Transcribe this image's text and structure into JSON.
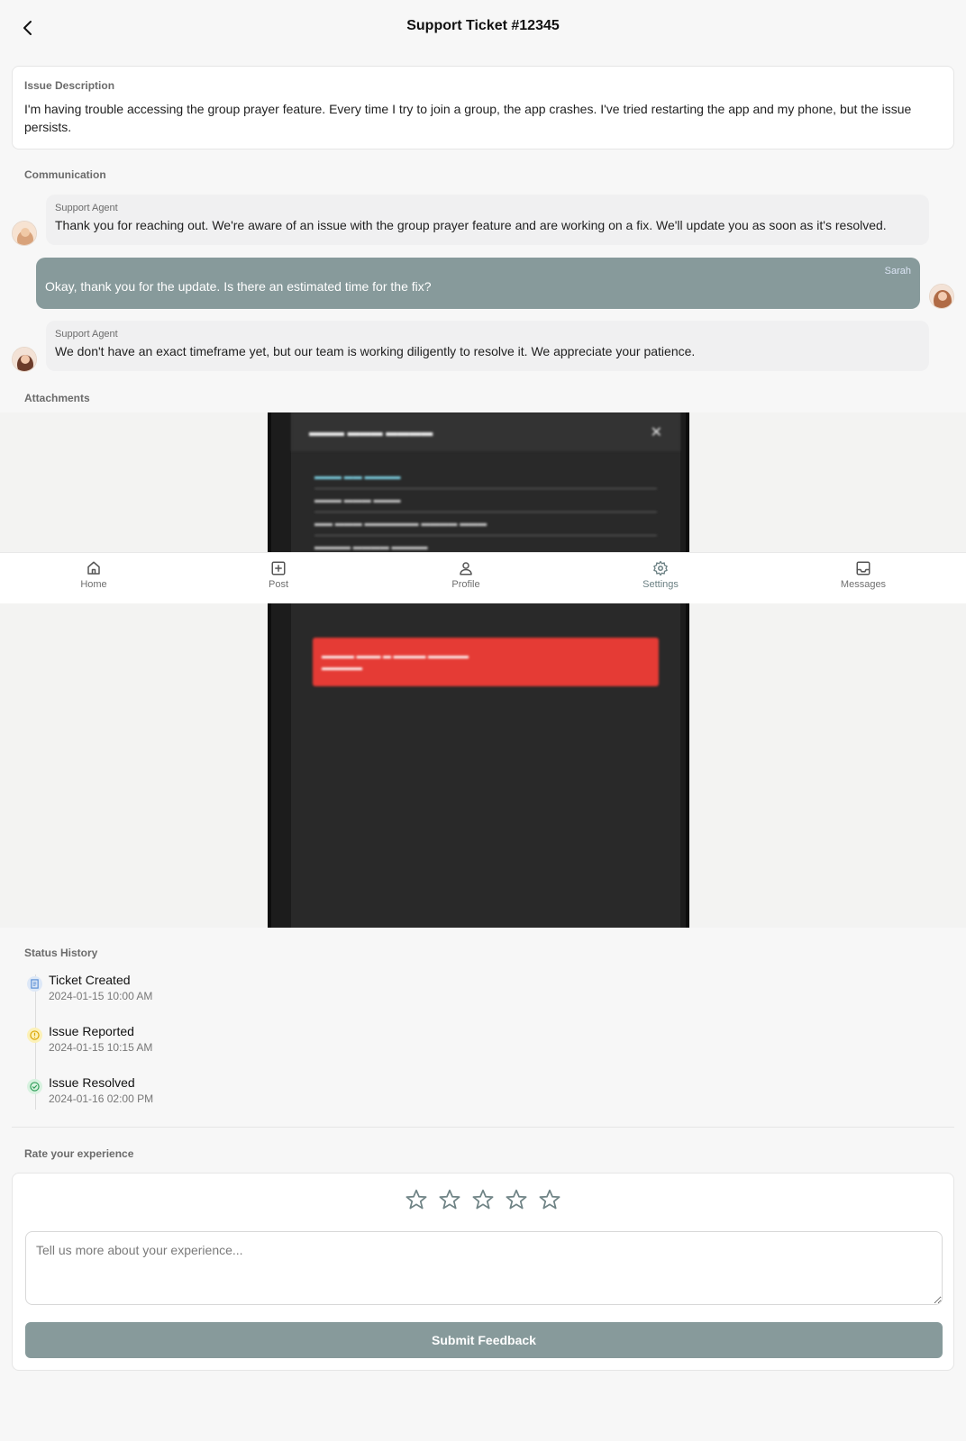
{
  "header": {
    "title": "Support Ticket #12345"
  },
  "issue": {
    "label": "Issue Description",
    "text": "I'm having trouble accessing the group prayer feature. Every time I try to join a group, the app crashes. I've tried restarting the app and my phone, but the issue persists."
  },
  "communication": {
    "label": "Communication",
    "messages": [
      {
        "sender": "Support Agent",
        "text": "Thank you for reaching out. We're aware of an issue with the group prayer feature and are working on a fix. We'll update you as soon as it's resolved."
      },
      {
        "sender": "Sarah",
        "text": "Okay, thank you for the update. Is there an estimated time for the fix?"
      },
      {
        "sender": "Support Agent",
        "text": "We don't have an exact timeframe yet, but our team is working diligently to resolve it. We appreciate your patience."
      }
    ]
  },
  "attachments": {
    "label": "Attachments"
  },
  "tabs": [
    {
      "label": "Home",
      "icon": "home-icon"
    },
    {
      "label": "Post",
      "icon": "plus-square-icon"
    },
    {
      "label": "Profile",
      "icon": "user-icon"
    },
    {
      "label": "Settings",
      "icon": "gear-icon",
      "active": true
    },
    {
      "label": "Messages",
      "icon": "inbox-icon"
    }
  ],
  "status_history": {
    "label": "Status History",
    "items": [
      {
        "title": "Ticket Created",
        "time": "2024-01-15 10:00 AM",
        "icon": "document-icon",
        "color": "#5b8fd6"
      },
      {
        "title": "Issue Reported",
        "time": "2024-01-15 10:15 AM",
        "icon": "alert-circle-icon",
        "color": "#d9a400"
      },
      {
        "title": "Issue Resolved",
        "time": "2024-01-16 02:00 PM",
        "icon": "check-circle-icon",
        "color": "#2e9d57"
      }
    ]
  },
  "rating": {
    "label": "Rate your experience",
    "stars_selected": 0,
    "stars_total": 5,
    "placeholder": "Tell us more about your experience...",
    "submit_label": "Submit Feedback"
  },
  "colors": {
    "accent": "#879a9b",
    "background": "#f7f7f7"
  }
}
